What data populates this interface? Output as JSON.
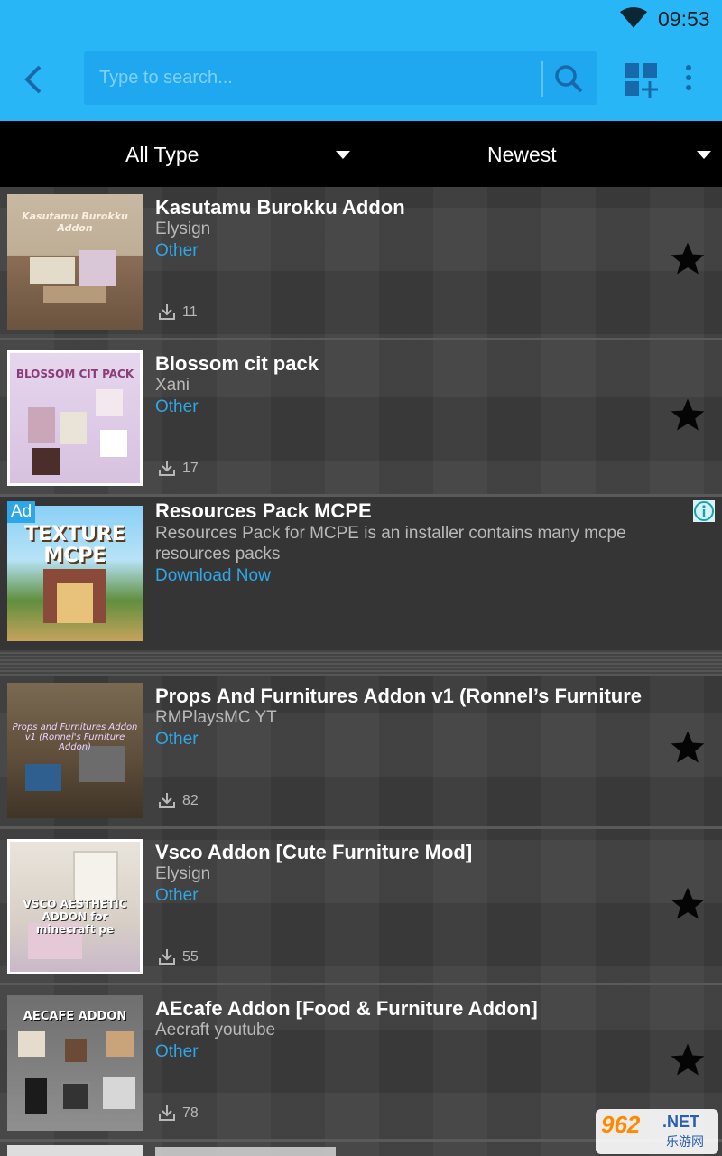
{
  "status_bar": {
    "time": "09:53",
    "wifi_icon": "wifi-icon"
  },
  "app_bar": {
    "back_icon": "chevron-left-icon",
    "search_placeholder": "Type to search...",
    "search_icon": "search-icon",
    "grid_icon": "grid-add-icon",
    "more_icon": "more-vertical-icon",
    "color": "#29b6f6"
  },
  "filters": {
    "type": "All Type",
    "sort": "Newest"
  },
  "items": [
    {
      "title": "Kasutamu Burokku Addon",
      "author": "Elysign",
      "category": "Other",
      "downloads": "11",
      "thumb_caption": "Kasutamu Burokku Addon"
    },
    {
      "title": "Blossom cit pack",
      "author": "Xani",
      "category": "Other",
      "downloads": "17",
      "thumb_caption": "BLOSSOM CIT PACK"
    },
    {
      "title": "Props And Furnitures Addon v1 (Ronnel’s Furniture",
      "author": "RMPlaysMC YT",
      "category": "Other",
      "downloads": "82",
      "thumb_caption": "Props and Furnitures Addon v1 (Ronnel's Furniture Addon)"
    },
    {
      "title": "Vsco Addon [Cute Furniture Mod]",
      "author": "Elysign",
      "category": "Other",
      "downloads": "55",
      "thumb_caption": "VSCO AESTHETIC ADDON for minecraft pe"
    },
    {
      "title": "AEcafe Addon [Food & Furniture Addon]",
      "author": "Aecraft youtube",
      "category": "Other",
      "downloads": "78",
      "thumb_caption": "AECAFE ADDON"
    }
  ],
  "ad": {
    "badge": "Ad",
    "title": "Resources Pack MCPE",
    "description": "Resources Pack for MCPE is an installer contains many mcpe resources packs",
    "cta": "Download Now",
    "thumb_caption": "TEXTURE MCPE"
  },
  "watermark": {
    "number": "962",
    "net": ".NET",
    "cn": "乐游网"
  },
  "colors": {
    "accent": "#2ea7e8",
    "filter_bar": "#000000",
    "list_bg": "#3e3e3e"
  }
}
